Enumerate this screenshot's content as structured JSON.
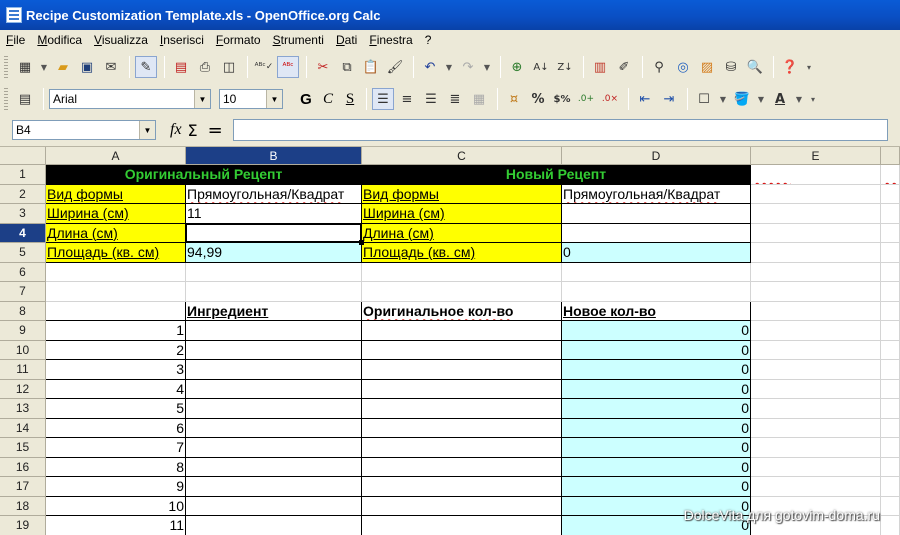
{
  "window": {
    "title": "Recipe Customization Template.xls - OpenOffice.org Calc"
  },
  "menu": [
    "File",
    "Modifica",
    "Visualizza",
    "Inserisci",
    "Formato",
    "Strumenti",
    "Dati",
    "Finestra",
    "?"
  ],
  "format_toolbar": {
    "font_name": "Arial",
    "font_size": "10",
    "bold": "G",
    "italic": "C",
    "underline": "S",
    "percent": "%"
  },
  "formula_bar": {
    "name_box": "B4",
    "fx": "fx",
    "sigma": "Σ",
    "equals": "=",
    "content": ""
  },
  "columns": [
    "A",
    "B",
    "C",
    "D",
    "E"
  ],
  "rows": [
    "1",
    "2",
    "3",
    "4",
    "5",
    "6",
    "7",
    "8",
    "9",
    "10",
    "11",
    "12",
    "13",
    "14",
    "15",
    "16",
    "17",
    "18",
    "19"
  ],
  "sheet": {
    "orig_header": "Оригинальный Рецепт",
    "new_header": "Новый Рецепт",
    "shape_label": "Вид формы",
    "shape_value": "Прямоугольная/Квадрат",
    "width_label": "Ширина (см)",
    "width_value": "11",
    "length_label": "Длина (см)",
    "area_label": "Площадь (кв. см)",
    "area_orig": "94,99",
    "area_new": "0",
    "new_shape_label": "Вид формы",
    "new_shape_value": "Прямоугольная/Квадрат",
    "new_width_label": "Ширина (см)",
    "new_length_label": "Длина (см)",
    "new_area_label": "Площадь (кв. см)",
    "ingredient_header": "Ингредиент",
    "orig_qty_header": "Оригинальное кол-во",
    "new_qty_header": "Новое кол-во",
    "numbers": [
      "1",
      "2",
      "3",
      "4",
      "5",
      "6",
      "7",
      "8",
      "9",
      "10",
      "11"
    ],
    "new_qty": [
      "0",
      "0",
      "0",
      "0",
      "0",
      "0",
      "0",
      "0",
      "0",
      "0",
      "0"
    ]
  },
  "watermark": "DolceVita для gotovim-doma.ru",
  "colors": {
    "title_bar": "#0a4fc4",
    "header_black": "#000000",
    "header_green": "#33cc33",
    "yellow": "#ffff00",
    "cyan": "#ccffff",
    "selection": "#1c3f87"
  }
}
